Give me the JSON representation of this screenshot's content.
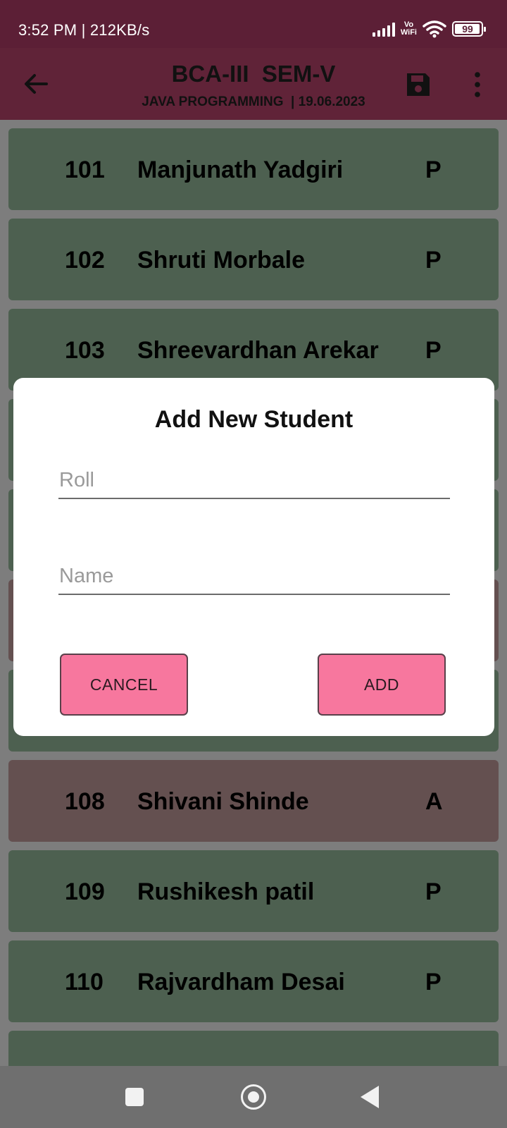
{
  "status_bar": {
    "time_speed": "3:52 PM | 212KB/s",
    "network_label_top": "Vo",
    "network_label_bottom": "WiFi",
    "battery": "99"
  },
  "app_bar": {
    "title": "BCA-III  SEM-V",
    "subtitle": "JAVA PROGRAMMING  | 19.06.2023"
  },
  "students": [
    {
      "roll": "101",
      "name": "Manjunath Yadgiri",
      "status": "P"
    },
    {
      "roll": "102",
      "name": "Shruti Morbale",
      "status": "P"
    },
    {
      "roll": "103",
      "name": "Shreevardhan Arekar",
      "status": "P"
    },
    {
      "roll": "108",
      "name": "Shivani Shinde",
      "status": "A"
    },
    {
      "roll": "109",
      "name": "Rushikesh patil",
      "status": "P"
    },
    {
      "roll": "110",
      "name": "Rajvardham Desai",
      "status": "P"
    }
  ],
  "dialog": {
    "title": "Add New Student",
    "roll_placeholder": "Roll",
    "name_placeholder": "Name",
    "cancel_label": "CANCEL",
    "add_label": "ADD"
  },
  "colors": {
    "app_bar": "#602338",
    "present_row": "#4d6050",
    "absent_row": "#645050",
    "button": "#f7779e"
  }
}
